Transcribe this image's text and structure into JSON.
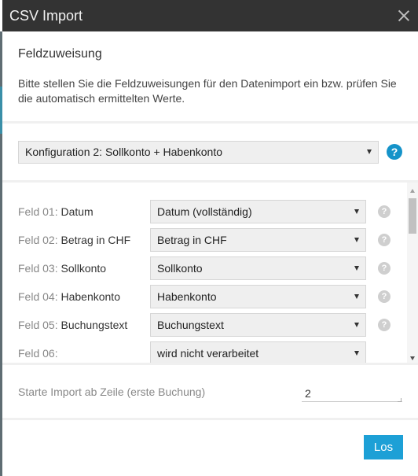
{
  "dialog": {
    "title": "CSV Import"
  },
  "intro": {
    "heading": "Feldzuweisung",
    "description": "Bitte stellen Sie die Feldzuweisungen für den Datenimport ein bzw. prüfen Sie die automatisch ermittelten Werte."
  },
  "config": {
    "selected": "Konfiguration 2: Sollkonto + Habenkonto",
    "help_icon": "?"
  },
  "fields": [
    {
      "num": "Feld 01:",
      "name": "Datum",
      "value": "Datum (vollständig)"
    },
    {
      "num": "Feld 02:",
      "name": "Betrag in CHF",
      "value": "Betrag in CHF"
    },
    {
      "num": "Feld 03:",
      "name": "Sollkonto",
      "value": "Sollkonto"
    },
    {
      "num": "Feld 04:",
      "name": "Habenkonto",
      "value": "Habenkonto"
    },
    {
      "num": "Feld 05:",
      "name": "Buchungstext",
      "value": "Buchungstext"
    },
    {
      "num": "Feld 06:",
      "name": "",
      "value": "wird nicht verarbeitet"
    }
  ],
  "field_help_icon": "?",
  "start": {
    "label": "Starte Import ab Zeile (erste Buchung)",
    "value": "2"
  },
  "footer": {
    "submit_label": "Los"
  },
  "colors": {
    "titlebar": "#333333",
    "accent": "#1da0d6",
    "help_blue": "#1593c9"
  }
}
